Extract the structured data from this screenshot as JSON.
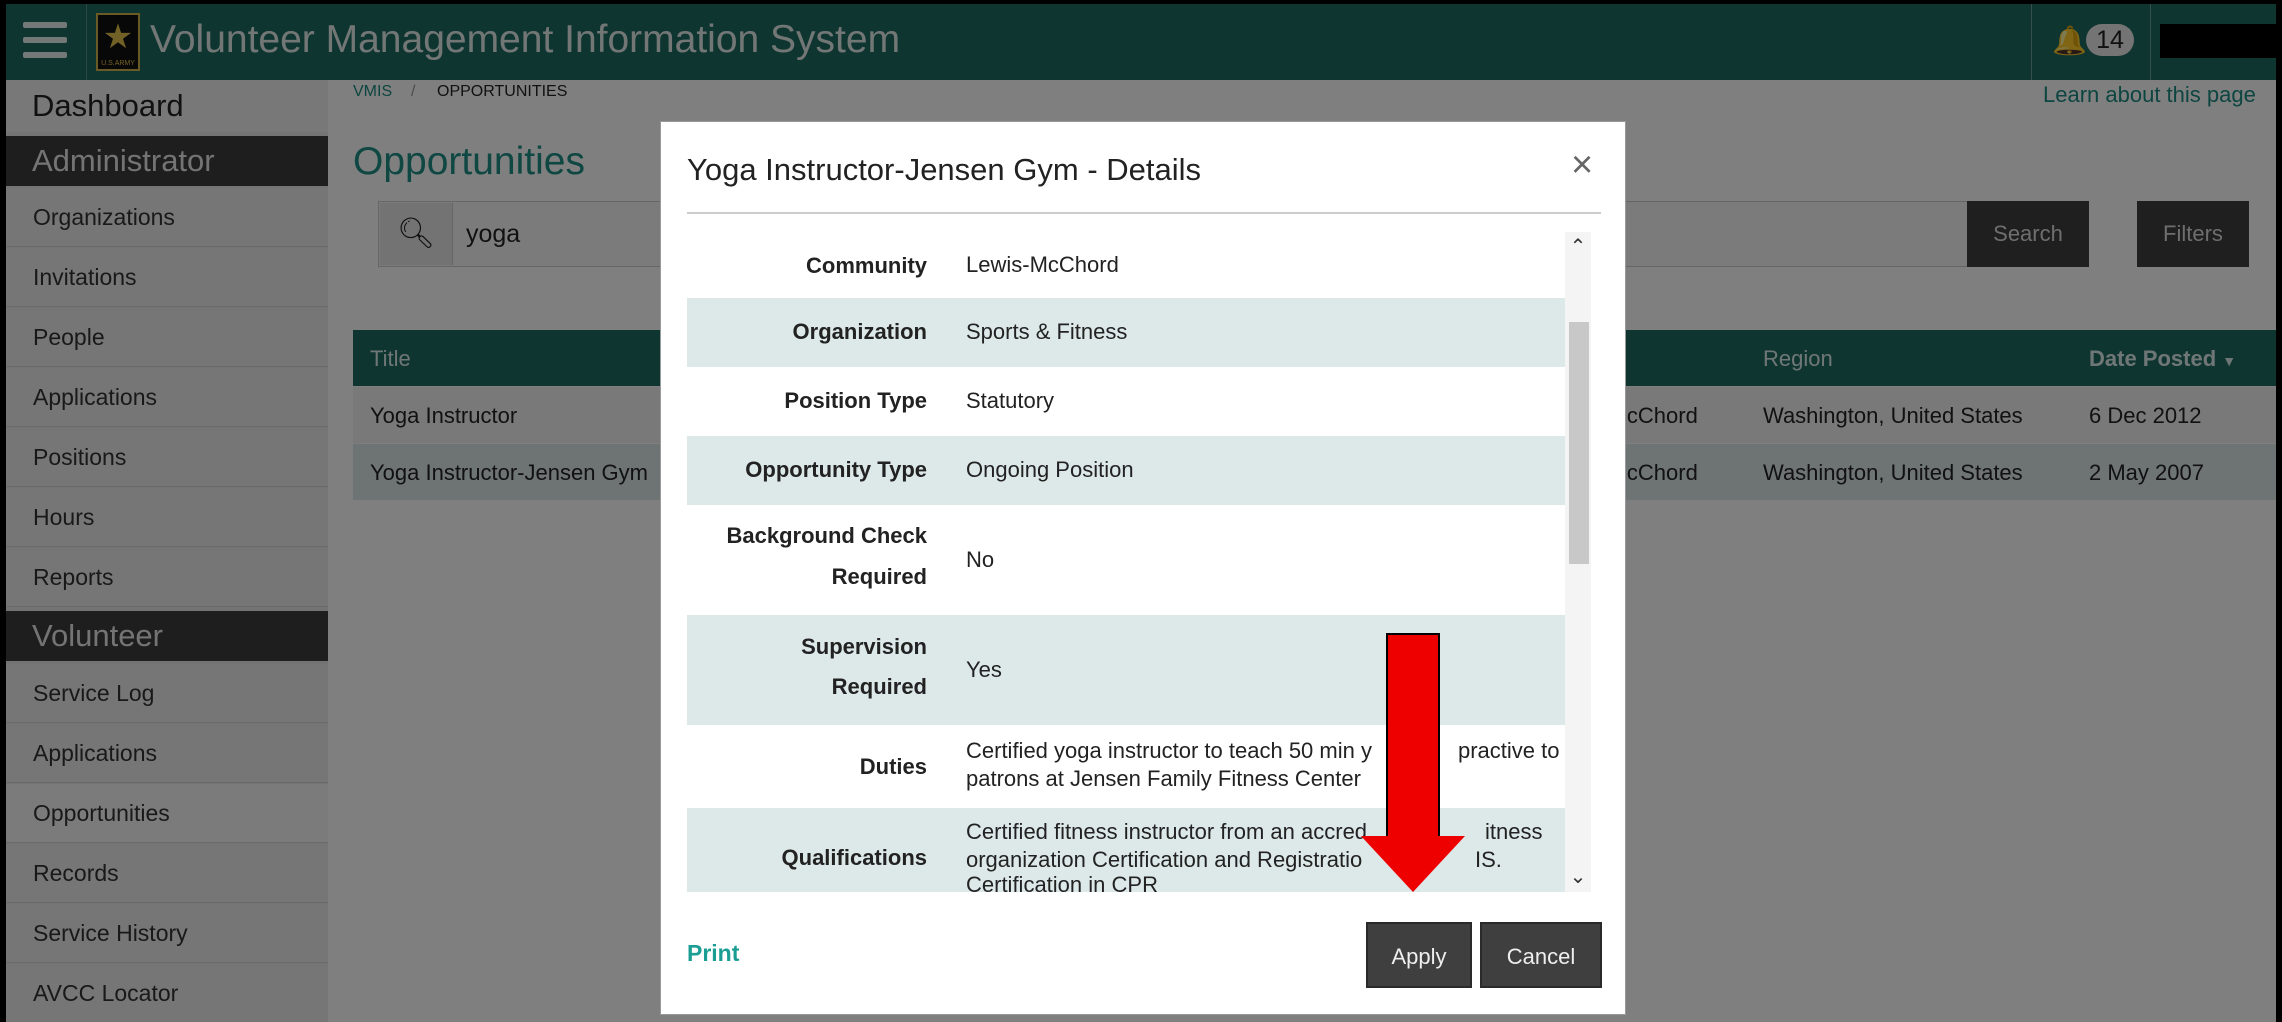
{
  "header": {
    "app_title": "Volunteer Management Information System",
    "notification_count": "14",
    "logo_text": "U.S.ARMY"
  },
  "breadcrumb": {
    "root": "VMIS",
    "sep": "/",
    "current": "OPPORTUNITIES"
  },
  "learn_link": "Learn about this page",
  "sidebar": {
    "dashboard": "Dashboard",
    "admin_header": "Administrator",
    "admin_items": [
      "Organizations",
      "Invitations",
      "People",
      "Applications",
      "Positions",
      "Hours",
      "Reports"
    ],
    "vol_header": "Volunteer",
    "vol_items": [
      "Service Log",
      "Applications",
      "Opportunities",
      "Records",
      "Service History",
      "AVCC Locator"
    ]
  },
  "page": {
    "title": "Opportunities",
    "search_value": "yoga",
    "search_button": "Search",
    "filters_button": "Filters",
    "columns": {
      "title": "Title",
      "region": "Region",
      "date_posted": "Date Posted"
    },
    "rows": [
      {
        "title": "Yoga Instructor",
        "community_fragment": "lcChord",
        "region": "Washington, United States",
        "date": "6 Dec 2012"
      },
      {
        "title": "Yoga Instructor-Jensen Gym",
        "community_fragment": "lcChord",
        "region": "Washington, United States",
        "date": "2 May 2007"
      }
    ]
  },
  "modal": {
    "title": "Yoga Instructor-Jensen Gym - Details",
    "close": "×",
    "fields": {
      "community": {
        "label": "Community",
        "value": "Lewis-McChord"
      },
      "organization": {
        "label": "Organization",
        "value": "Sports & Fitness"
      },
      "position_type": {
        "label": "Position Type",
        "value": "Statutory"
      },
      "opportunity_type": {
        "label": "Opportunity Type",
        "value": "Ongoing Position"
      },
      "background_check": {
        "label_1": "Background Check",
        "label_2": "Required",
        "value": "No"
      },
      "supervision": {
        "label_1": "Supervision",
        "label_2": "Required",
        "value": "Yes"
      },
      "duties": {
        "label": "Duties",
        "value_1": "Certified yoga instructor to teach 50 min y",
        "value_2": "practive to",
        "value_3": "patrons at Jensen Family Fitness Center"
      },
      "qualifications": {
        "label": "Qualifications",
        "value_1": "Certified fitness instructor from an accred",
        "value_2": "itness",
        "value_3": "organization Certification and Registratio",
        "value_4": "IS.",
        "value_5": "Certification in CPR"
      }
    },
    "print": "Print",
    "apply": "Apply",
    "cancel": "Cancel"
  },
  "colors": {
    "header_teal": "#1f6b62",
    "link_teal": "#1a9e94",
    "annotation_arrow": "#ee0000"
  }
}
